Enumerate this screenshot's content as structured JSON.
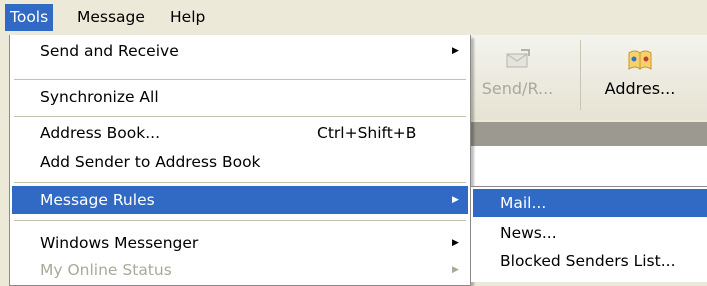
{
  "menubar": {
    "items": [
      {
        "label": "Tools",
        "active": true
      },
      {
        "label": "Message",
        "active": false
      },
      {
        "label": "Help",
        "active": false
      }
    ]
  },
  "tools_menu": {
    "items": [
      {
        "label": "Send and Receive",
        "submenu": true
      },
      {
        "label": "Synchronize All"
      },
      {
        "label": "Address Book...",
        "shortcut": "Ctrl+Shift+B"
      },
      {
        "label": "Add Sender to Address Book"
      },
      {
        "label": "Message Rules",
        "submenu": true,
        "highlighted": true
      },
      {
        "label": "Windows Messenger",
        "submenu": true
      },
      {
        "label": "My Online Status",
        "submenu": true,
        "disabled": true
      }
    ]
  },
  "message_rules_submenu": {
    "items": [
      {
        "label": "Mail...",
        "highlighted": true
      },
      {
        "label": "News..."
      },
      {
        "label": "Blocked Senders List..."
      }
    ]
  },
  "toolbar": {
    "buttons": [
      {
        "label": "Send/R...",
        "icon": "send-receive-icon",
        "disabled": true
      },
      {
        "label": "Addres...",
        "icon": "address-book-icon"
      }
    ]
  },
  "colors": {
    "highlight": "#316ac5",
    "menu_bg": "#ece9d8",
    "disabled_text": "#aca899"
  }
}
